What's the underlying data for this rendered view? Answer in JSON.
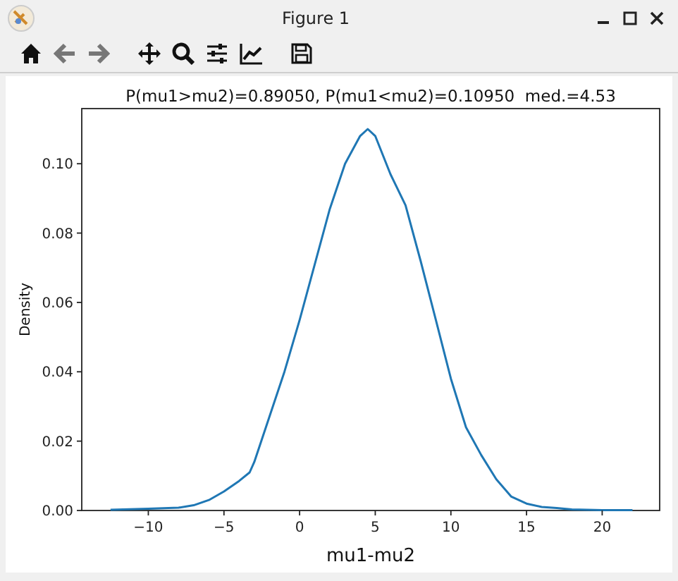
{
  "window": {
    "title": "Figure 1"
  },
  "toolbar": {
    "buttons": [
      {
        "kind": "home"
      },
      {
        "kind": "back"
      },
      {
        "kind": "forward"
      },
      {
        "kind": "separator"
      },
      {
        "kind": "pan"
      },
      {
        "kind": "zoom"
      },
      {
        "kind": "configure"
      },
      {
        "kind": "edit"
      },
      {
        "kind": "separator"
      },
      {
        "kind": "save"
      }
    ]
  },
  "figure": {
    "chart_data": {
      "type": "line",
      "title": "P(mu1>mu2)=0.89050, P(mu1<mu2)=0.10950  med.=4.53",
      "xlabel": "mu1-mu2",
      "ylabel": "Density",
      "x": [
        -12.5,
        -10,
        -8,
        -7,
        -6,
        -5,
        -4,
        -3.3,
        -3,
        -2,
        -1,
        0,
        1,
        2,
        3,
        4,
        4.5,
        5,
        6,
        7,
        8,
        9,
        10,
        11,
        12,
        13,
        14,
        15,
        16,
        17,
        18,
        20,
        22
      ],
      "series": [
        {
          "color": "#1f77b4",
          "values": [
            0.0002,
            0.0005,
            0.0008,
            0.0015,
            0.003,
            0.0055,
            0.0085,
            0.011,
            0.014,
            0.027,
            0.04,
            0.055,
            0.071,
            0.087,
            0.1,
            0.108,
            0.11,
            0.108,
            0.097,
            0.088,
            0.072,
            0.055,
            0.038,
            0.024,
            0.016,
            0.009,
            0.004,
            0.002,
            0.001,
            0.0007,
            0.0003,
            0.0001,
            0.0001
          ]
        }
      ],
      "xlim": [
        -14.4,
        23.8
      ],
      "ylim": [
        0,
        0.1159
      ],
      "xticks": [
        {
          "value": -10,
          "label": "−10"
        },
        {
          "value": -5,
          "label": "−5"
        },
        0,
        5,
        10,
        15,
        20
      ],
      "yticks": [
        {
          "value": 0,
          "label": "0.00"
        },
        {
          "value": 0.02,
          "label": "0.02"
        },
        {
          "value": 0.04,
          "label": "0.04"
        },
        {
          "value": 0.06,
          "label": "0.06"
        },
        {
          "value": 0.08,
          "label": "0.08"
        },
        {
          "value": 0.1,
          "label": "0.10"
        }
      ]
    }
  }
}
